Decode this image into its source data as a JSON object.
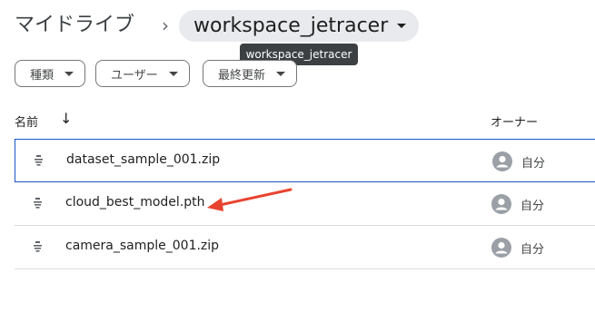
{
  "breadcrumb": {
    "root": "マイドライブ",
    "separator": "›",
    "current": "workspace_jetracer",
    "tooltip": "workspace_jetracer"
  },
  "filters": [
    {
      "label": "種類"
    },
    {
      "label": "ユーザー"
    },
    {
      "label": "最終更新"
    }
  ],
  "columns": {
    "name": "名前",
    "sort_icon": "arrow-down-icon",
    "owner": "オーナー"
  },
  "files": [
    {
      "name": "dataset_sample_001.zip",
      "owner": "自分",
      "selected": true
    },
    {
      "name": "cloud_best_model.pth",
      "owner": "自分",
      "selected": false
    },
    {
      "name": "camera_sample_001.zip",
      "owner": "自分",
      "selected": false
    }
  ],
  "annotation": {
    "color": "#e8432e",
    "icon": "red-arrow-annotation"
  }
}
